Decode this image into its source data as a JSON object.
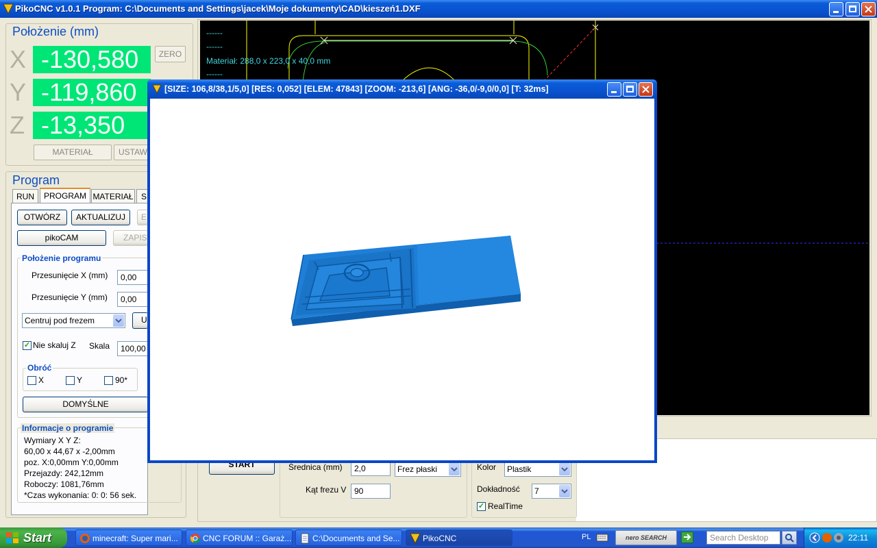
{
  "window": {
    "title": "PikoCNC v1.0.1    Program: C:\\Documents and Settings\\jacek\\Moje dokumenty\\CAD\\kieszeń1.DXF"
  },
  "position": {
    "heading": "Położenie (mm)",
    "axes": [
      {
        "label": "X",
        "value": "-130,580"
      },
      {
        "label": "Y",
        "value": "-119,860"
      },
      {
        "label": "Z",
        "value": "-13,350"
      }
    ],
    "zero_label": "ZERO",
    "material_label": "MATERIAŁ",
    "set_label": "USTAW"
  },
  "program": {
    "heading": "Program",
    "tabs": [
      "RUN",
      "PROGRAM",
      "MATERIAŁ",
      "S"
    ],
    "open_label": "OTWÓRZ",
    "update_label": "AKTUALIZUJ",
    "e_label": "E",
    "pikocam_label": "pikoCAM",
    "save_label": "ZAPISZ",
    "position_group": "Położenie programu",
    "shift_x_label": "Przesunięcie X (mm)",
    "shift_x_value": "0,00",
    "shift_y_label": "Przesunięcie Y (mm)",
    "shift_y_value": "0,00",
    "center_option": "Centruj pod frezem",
    "u_label": "U",
    "no_scale_z_label": "Nie skaluj Z",
    "no_scale_z_checked": true,
    "scale_label": "Skala",
    "scale_value": "100,00",
    "rotate_group": "Obróć",
    "rotate_x": "X",
    "rotate_y": "Y",
    "rotate_90": "90*",
    "defaults_label": "DOMYŚLNE",
    "info_group": "Informacje o programie",
    "info_lines": [
      "Wymiary X Y Z:",
      "60,00 x 44,67 x -2,00mm",
      "poz. X:0,00mm Y:0,00mm",
      "Przejazdy: 242,12mm",
      "Roboczy: 1081,76mm",
      "*Czas wykonania: 0: 0: 56 sek."
    ]
  },
  "cad": {
    "dash1": "------",
    "dash2": "------",
    "material_text": "Materiał: 288,0 x 223,0 x 40,0 mm",
    "dash3": "------"
  },
  "bottom": {
    "start_label": "START",
    "diameter_label": "Średnica (mm)",
    "diameter_value": "2,0",
    "cutter_type": "Frez płaski",
    "angle_label": "Kąt frezu V",
    "angle_value": "90",
    "color_label": "Kolor",
    "color_value": "Plastik",
    "accuracy_label": "Dokładność",
    "accuracy_value": "7",
    "realtime_label": "RealTime",
    "realtime_checked": true
  },
  "preview": {
    "title": "[SIZE: 106,8/38,1/5,0] [RES: 0,052] [ELEM: 47843] [ZOOM: -213,6] [ANG: -36,0/-9,0/0,0] [T: 32ms]",
    "model_color": "#1f7fd8"
  },
  "taskbar": {
    "start_label": "Start",
    "items": [
      "minecraft: Super mari...",
      "CNC FORUM :: Garaż...",
      "C:\\Documents and Se...",
      "PikoCNC"
    ],
    "lang": "PL",
    "nero_label": "nero SEARCH",
    "search_placeholder": "Search Desktop",
    "clock": "22:11"
  }
}
